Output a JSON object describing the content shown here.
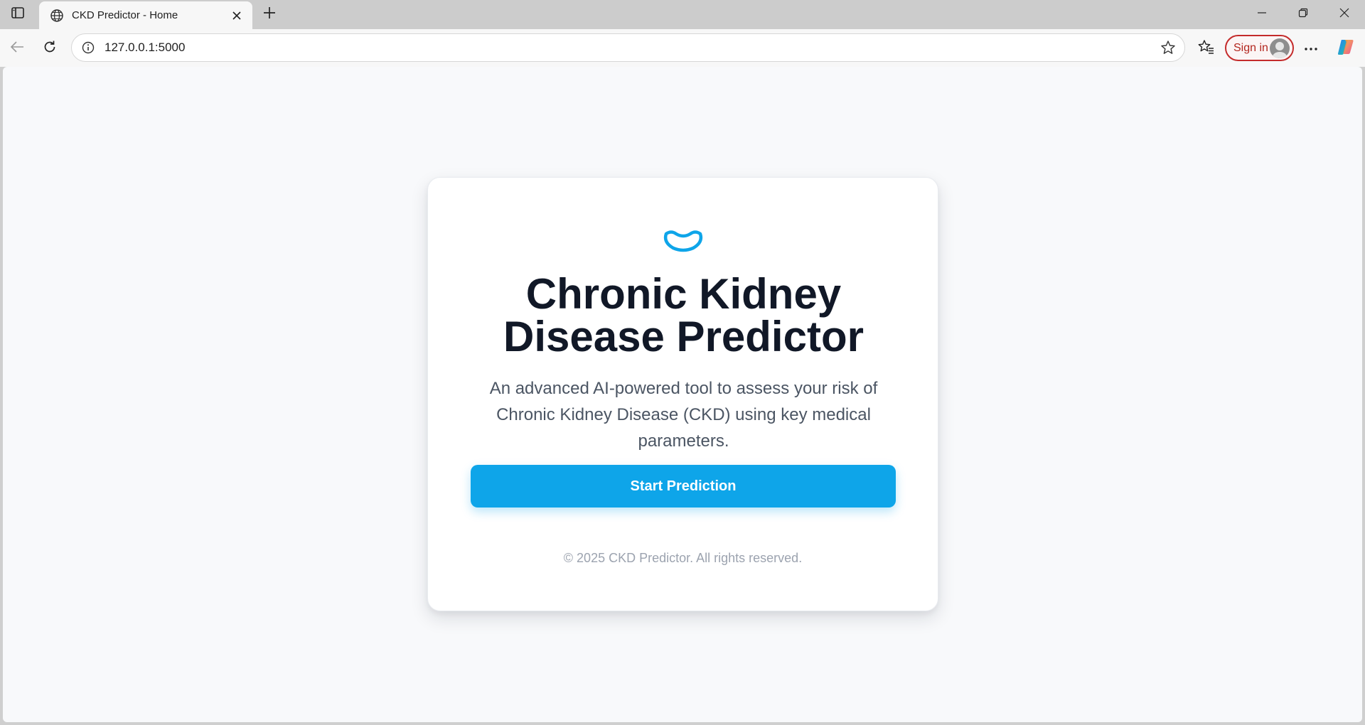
{
  "browser": {
    "tab_title": "CKD Predictor - Home",
    "url": "127.0.0.1:5000",
    "signin_label": "Sign in",
    "icons": {
      "sidebar": "sidebar-toggle-icon",
      "favicon": "globe-icon",
      "close": "close-icon",
      "new_tab": "plus-icon",
      "back": "back-arrow-icon",
      "reload": "reload-icon",
      "site_info": "info-icon",
      "favorite": "star-icon",
      "favorites": "favorites-icon",
      "menu": "more-icon",
      "copilot": "copilot-icon"
    }
  },
  "page": {
    "title": "Chronic Kidney Disease Predictor",
    "description": "An advanced AI-powered tool to assess your risk of Chronic Kidney Disease (CKD) using key medical parameters.",
    "cta_label": "Start Prediction",
    "footer": "© 2025 CKD Predictor. All rights reserved.",
    "logo_icon": "kidney-icon"
  },
  "colors": {
    "accent": "#0ea5e9",
    "heading": "#111827",
    "body_text": "#4b5563",
    "muted_text": "#9ca3af",
    "signin_border": "#c42b2b"
  }
}
